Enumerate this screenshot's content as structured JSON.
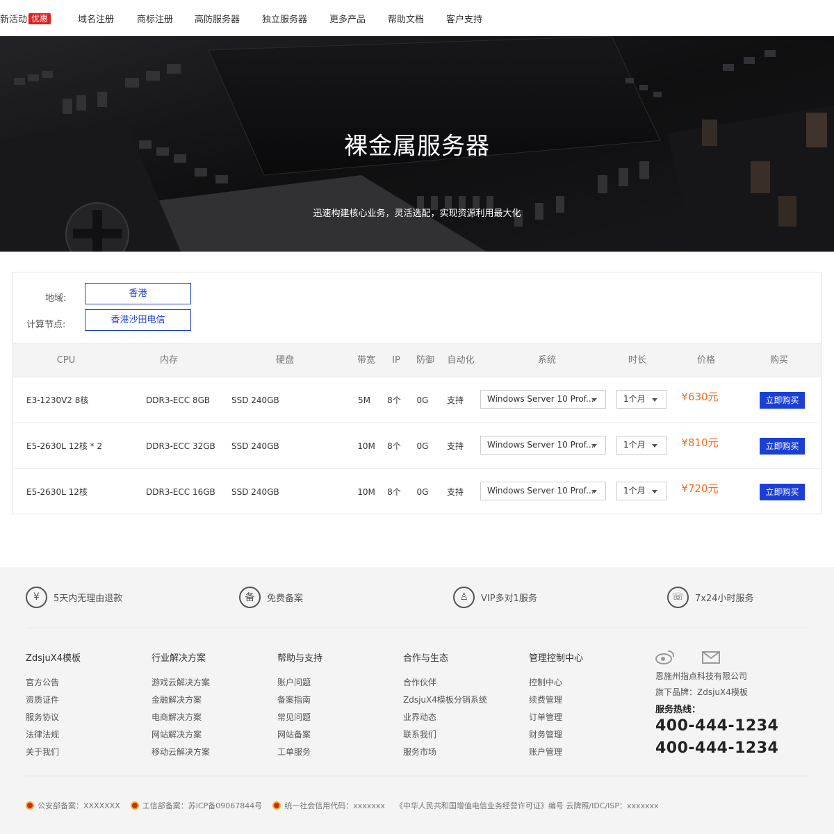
{
  "nav": {
    "items": [
      {
        "label": "新活动",
        "badge": "优惠"
      },
      {
        "label": "域名注册"
      },
      {
        "label": "商标注册"
      },
      {
        "label": "高防服务器"
      },
      {
        "label": "独立服务器"
      },
      {
        "label": "更多产品"
      },
      {
        "label": "帮助文档"
      },
      {
        "label": "客户支持"
      }
    ]
  },
  "hero": {
    "title": "裸金属服务器",
    "subtitle": "迅速构建核心业务，灵活选配，实现资源利用最大化"
  },
  "filters": {
    "region_label": "地域:",
    "region_value": "香港",
    "node_label": "计算节点:",
    "node_value": "香港沙田电信"
  },
  "table": {
    "headers": [
      "CPU",
      "内存",
      "硬盘",
      "带宽",
      "IP",
      "防御",
      "自动化",
      "系统",
      "时长",
      "价格",
      "购买"
    ],
    "rows": [
      {
        "cpu": "E3-1230V2 8核",
        "memory": "DDR3-ECC 8GB",
        "disk": "SSD 240GB",
        "bandwidth": "5M",
        "ip": "8个",
        "defense": "0G",
        "auto": "支持",
        "os": "Windows Server 10 Prof...",
        "duration": "1个月",
        "price": "¥630元",
        "buy": "立即购买"
      },
      {
        "cpu": "E5-2630L 12核 * 2",
        "memory": "DDR3-ECC 32GB",
        "disk": "SSD 240GB",
        "bandwidth": "10M",
        "ip": "8个",
        "defense": "0G",
        "auto": "支持",
        "os": "Windows Server 10 Prof...",
        "duration": "1个月",
        "price": "¥810元",
        "buy": "立即购买"
      },
      {
        "cpu": "E5-2630L 12核",
        "memory": "DDR3-ECC 16GB",
        "disk": "SSD 240GB",
        "bandwidth": "10M",
        "ip": "8个",
        "defense": "0G",
        "auto": "支持",
        "os": "Windows Server 10 Prof...",
        "duration": "1个月",
        "price": "¥720元",
        "buy": "立即购买"
      }
    ]
  },
  "features": [
    {
      "icon": "yen-icon",
      "glyph": "¥",
      "label": "5天内无理由退款"
    },
    {
      "icon": "record-icon",
      "glyph": "备",
      "label": "免费备案"
    },
    {
      "icon": "vip-user-icon",
      "glyph": "♙",
      "label": "VIP多对1服务"
    },
    {
      "icon": "phone-icon",
      "glyph": "☏",
      "label": "7x24小时服务"
    }
  ],
  "footer_columns": [
    {
      "title": "ZdsjuX4模板",
      "links": [
        "官方公告",
        "资质证件",
        "服务协议",
        "法律法规",
        "关于我们"
      ]
    },
    {
      "title": "行业解决方案",
      "links": [
        "游戏云解决方案",
        "金融解决方案",
        "电商解决方案",
        "网站解决方案",
        "移动云解决方案"
      ]
    },
    {
      "title": "帮助与支持",
      "links": [
        "账户问题",
        "备案指南",
        "常见问题",
        "网站备案",
        "工单服务"
      ]
    },
    {
      "title": "合作与生态",
      "links": [
        "合作伙伴",
        "ZdsjuX4模板分销系统",
        "业界动态",
        "联系我们",
        "服务市场"
      ]
    },
    {
      "title": "管理控制中心",
      "links": [
        "控制中心",
        "续费管理",
        "订单管理",
        "财务管理",
        "账户管理"
      ]
    }
  ],
  "contact": {
    "company": "恩施州指点科技有限公司",
    "brand": "旗下品牌：ZdsjuX4模板",
    "hotline_label": "服务热线：",
    "phones": [
      "400-444-1234",
      "400-444-1234"
    ]
  },
  "bottom": {
    "police": "公安部备案：XXXXXXX",
    "miit": "工信部备案：苏ICP备09067844号",
    "credit": "统一社会信用代码：xxxxxxx",
    "license": "《中华人民共和国增值电信业务经营许可证》编号 云牌照/IDC/ISP：xxxxxxx"
  },
  "colors": {
    "accent": "#1b3fd6",
    "price": "#ff6a1a",
    "badge": "#e02020"
  }
}
